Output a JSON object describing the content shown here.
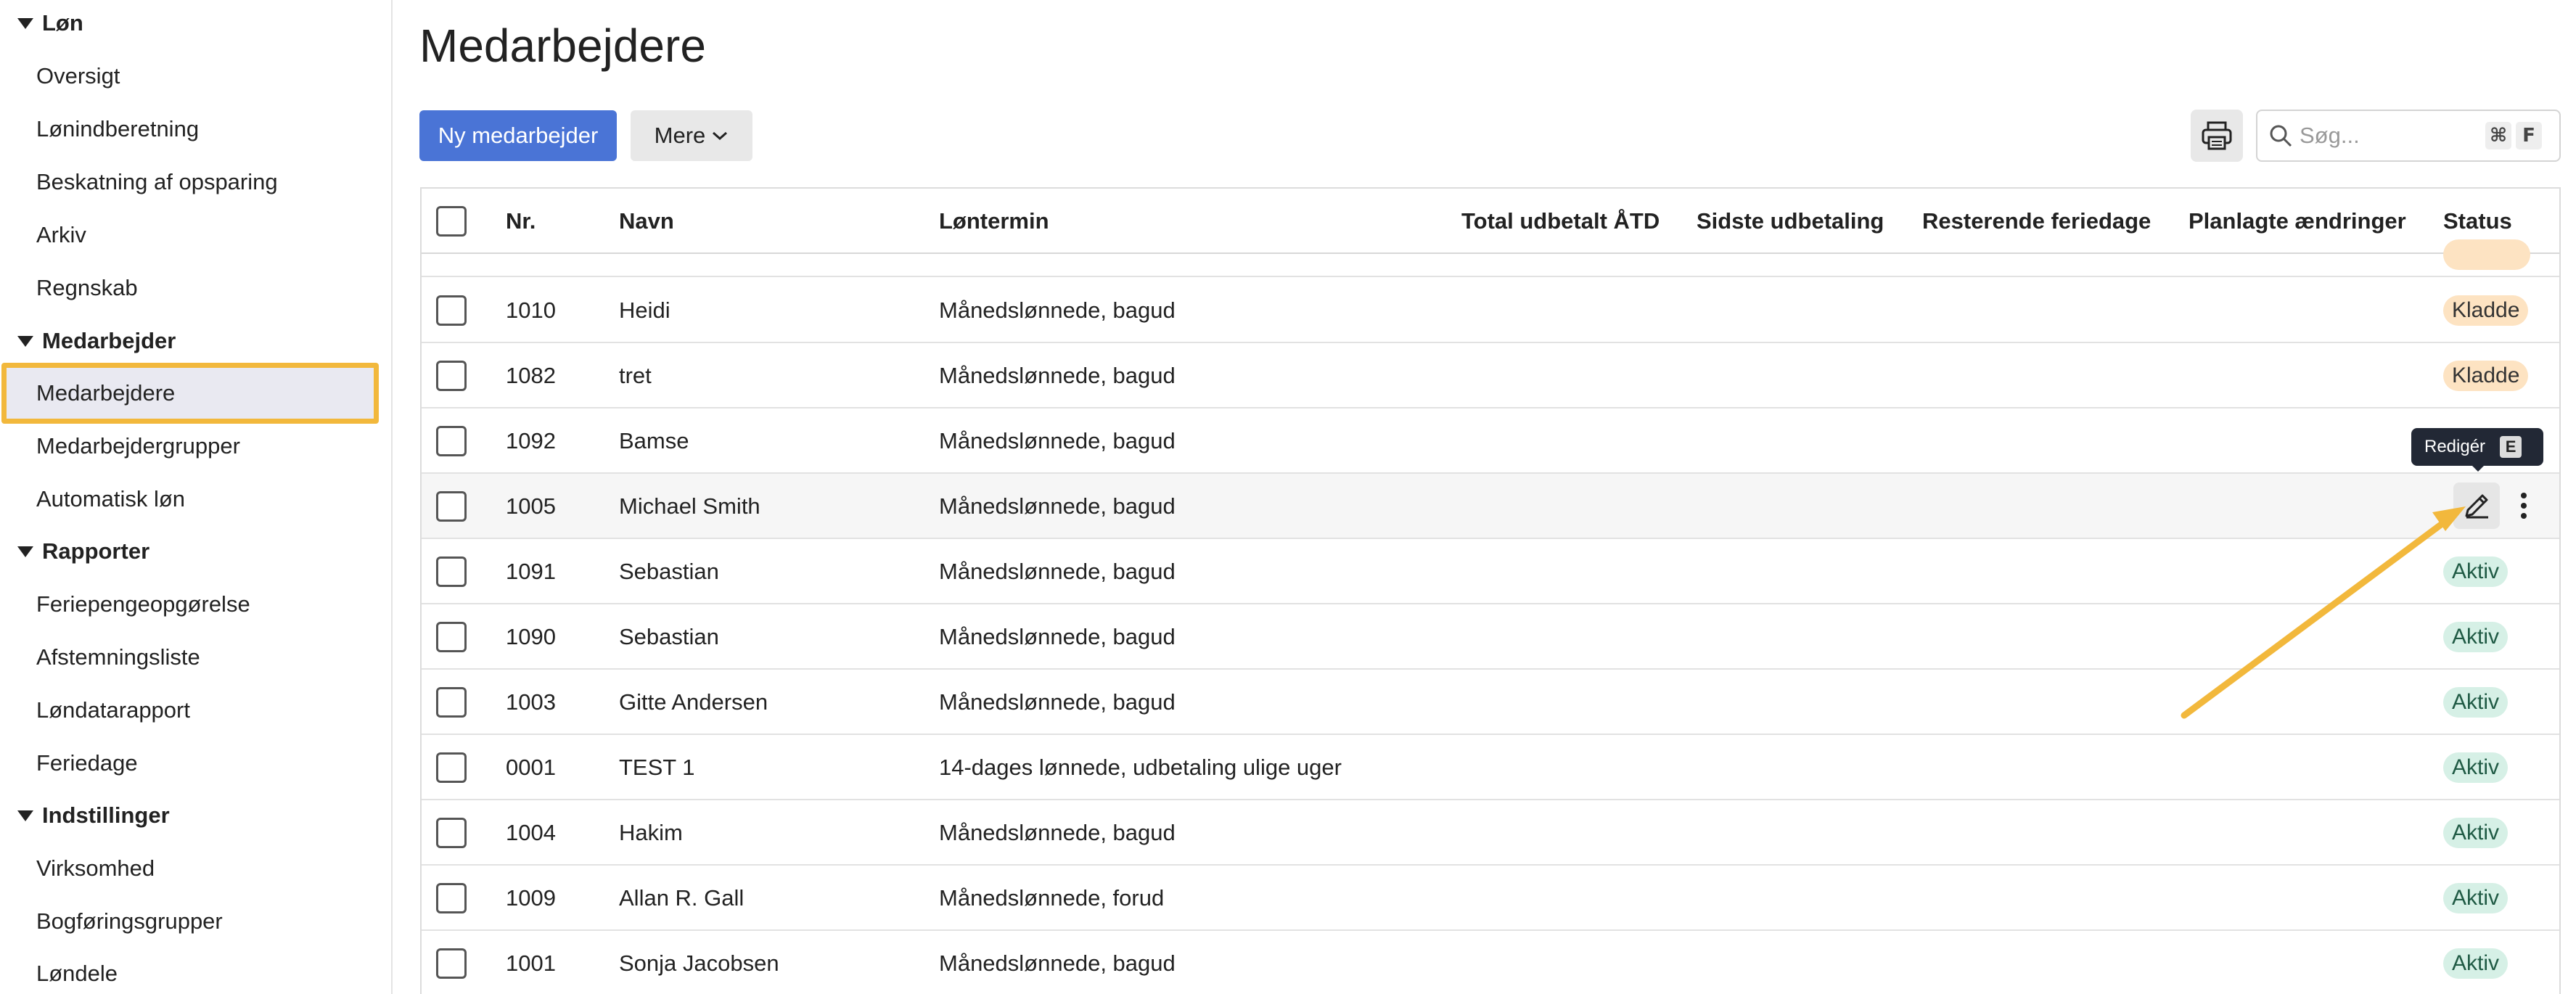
{
  "sidebar": {
    "sections": [
      {
        "label": "Løn",
        "items": [
          "Oversigt",
          "Lønindberetning",
          "Beskatning af opsparing",
          "Arkiv",
          "Regnskab"
        ]
      },
      {
        "label": "Medarbejder",
        "items": [
          "Medarbejdere",
          "Medarbejdergrupper",
          "Automatisk løn"
        ]
      },
      {
        "label": "Rapporter",
        "items": [
          "Feriepengeopgørelse",
          "Afstemningsliste",
          "Løndatarapport",
          "Feriedage"
        ]
      },
      {
        "label": "Indstillinger",
        "items": [
          "Virksomhed",
          "Bogføringsgrupper",
          "Løndele"
        ]
      }
    ],
    "active_item": "Medarbejdere"
  },
  "main": {
    "title": "Medarbejdere",
    "new_button": "Ny medarbejder",
    "more_button": "Mere",
    "search": {
      "placeholder": "Søg...",
      "shortcut_mod": "⌘",
      "shortcut_key": "F"
    }
  },
  "table": {
    "columns": {
      "nr": "Nr.",
      "navn": "Navn",
      "lontermin": "Løntermin",
      "total": "Total udbetalt ÅTD",
      "sidste": "Sidste udbetaling",
      "resterende": "Resterende feriedage",
      "planlagte": "Planlagte ændringer",
      "status": "Status"
    },
    "rows": [
      {
        "nr": "1010",
        "navn": "Heidi",
        "lontermin": "Månedslønnede, bagud",
        "status": "Kladde"
      },
      {
        "nr": "1082",
        "navn": "tret",
        "lontermin": "Månedslønnede, bagud",
        "status": "Kladde"
      },
      {
        "nr": "1092",
        "navn": "Bamse",
        "lontermin": "Månedslønnede, bagud",
        "status": ""
      },
      {
        "nr": "1005",
        "navn": "Michael Smith",
        "lontermin": "Månedslønnede, bagud",
        "status": ""
      },
      {
        "nr": "1091",
        "navn": "Sebastian",
        "lontermin": "Månedslønnede, bagud",
        "status": "Aktiv"
      },
      {
        "nr": "1090",
        "navn": "Sebastian",
        "lontermin": "Månedslønnede, bagud",
        "status": "Aktiv"
      },
      {
        "nr": "1003",
        "navn": "Gitte Andersen",
        "lontermin": "Månedslønnede, bagud",
        "status": "Aktiv"
      },
      {
        "nr": "0001",
        "navn": "TEST 1",
        "lontermin": "14-dages lønnede, udbetaling ulige uger",
        "status": "Aktiv"
      },
      {
        "nr": "1004",
        "navn": "Hakim",
        "lontermin": "Månedslønnede, bagud",
        "status": "Aktiv"
      },
      {
        "nr": "1009",
        "navn": "Allan R. Gall",
        "lontermin": "Månedslønnede, forud",
        "status": "Aktiv"
      },
      {
        "nr": "1001",
        "navn": "Sonja Jacobsen",
        "lontermin": "Månedslønnede, bagud",
        "status": "Aktiv"
      }
    ]
  },
  "tooltip": {
    "label": "Redigér",
    "key": "E"
  },
  "colors": {
    "primary": "#4a74d6",
    "highlight": "#f2b83c",
    "kladde": "#fde3c2",
    "aktiv": "#d6f0e6"
  }
}
